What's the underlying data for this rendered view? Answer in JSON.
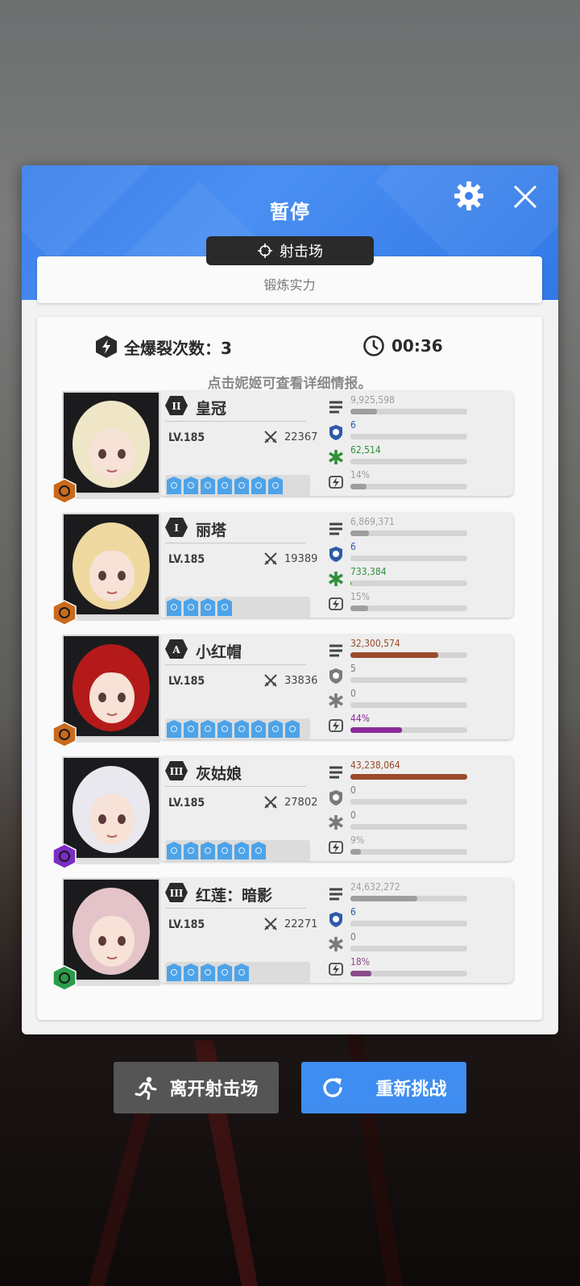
{
  "header": {
    "title": "暂停"
  },
  "mode": {
    "name": "射击场",
    "subtitle": "锻炼实力"
  },
  "stats": {
    "burst_label": "全爆裂次数：3",
    "timer": "00:36",
    "hint": "点击妮姬可查看详细情报。"
  },
  "colors": {
    "accent": "#3f8df0",
    "damage_high": "#a0522d",
    "burst_purple": "#8a2be2",
    "heal_green": "#2f8f3a"
  },
  "characters": [
    {
      "name": "皇冠",
      "rank": "II",
      "level": "LV.185",
      "power": "22367",
      "class": "burst-III",
      "skill_count": 7,
      "portrait_hair": "#efe6c8",
      "badge_color": "#c96a1c",
      "damage": "9,925,598",
      "damage_pct": 0.23,
      "damage_color": "#9e9e9e",
      "defense": "6",
      "defense_icon_color": "#2d5aa8",
      "heal": "62,514",
      "heal_pct": 0.0,
      "heal_color": "#2f8f3a",
      "burst": "14%",
      "burst_pct": 0.14,
      "burst_color": "#9e9e9e"
    },
    {
      "name": "丽塔",
      "rank": "I",
      "level": "LV.185",
      "power": "19389",
      "class": "burst-I",
      "skill_count": 4,
      "portrait_hair": "#f0d9a0",
      "badge_color": "#c96a1c",
      "damage": "6,869,371",
      "damage_pct": 0.16,
      "damage_color": "#9e9e9e",
      "defense": "6",
      "defense_icon_color": "#2d5aa8",
      "heal": "733,384",
      "heal_pct": 0.01,
      "heal_color": "#2f8f3a",
      "burst": "15%",
      "burst_pct": 0.15,
      "burst_color": "#9e9e9e"
    },
    {
      "name": "小红帽",
      "rank": "A",
      "level": "LV.185",
      "power": "33836",
      "class": "burst-III",
      "skill_count": 8,
      "portrait_hair": "#b51a1a",
      "badge_color": "#c96a1c",
      "damage": "32,300,574",
      "damage_pct": 0.75,
      "damage_color": "#9a4a2a",
      "defense": "5",
      "defense_icon_color": "#7a7a7a",
      "heal": "0",
      "heal_pct": 0,
      "heal_color": "#7a7a7a",
      "burst": "44%",
      "burst_pct": 0.44,
      "burst_color": "#8a2b9a"
    },
    {
      "name": "灰姑娘",
      "rank": "III",
      "level": "LV.185",
      "power": "27802",
      "class": "electric",
      "skill_count": 6,
      "portrait_hair": "#e8e8ee",
      "badge_color": "#7b2cc4",
      "damage": "43,238,064",
      "damage_pct": 1.0,
      "damage_color": "#9a4a2a",
      "defense": "0",
      "defense_icon_color": "#7a7a7a",
      "heal": "0",
      "heal_pct": 0,
      "heal_color": "#7a7a7a",
      "burst": "9%",
      "burst_pct": 0.09,
      "burst_color": "#9e9e9e"
    },
    {
      "name": "红莲：暗影",
      "rank": "III",
      "level": "LV.185",
      "power": "22271",
      "class": "wind",
      "skill_count": 5,
      "portrait_hair": "#e4c4c8",
      "badge_color": "#2c9a4a",
      "damage": "24,632,272",
      "damage_pct": 0.57,
      "damage_color": "#9e9e9e",
      "defense": "6",
      "defense_icon_color": "#2d5aa8",
      "heal": "0",
      "heal_pct": 0,
      "heal_color": "#7a7a7a",
      "burst": "18%",
      "burst_pct": 0.18,
      "burst_color": "#8a4a8a"
    }
  ],
  "buttons": {
    "leave": "离开射击场",
    "retry": "重新挑战"
  }
}
